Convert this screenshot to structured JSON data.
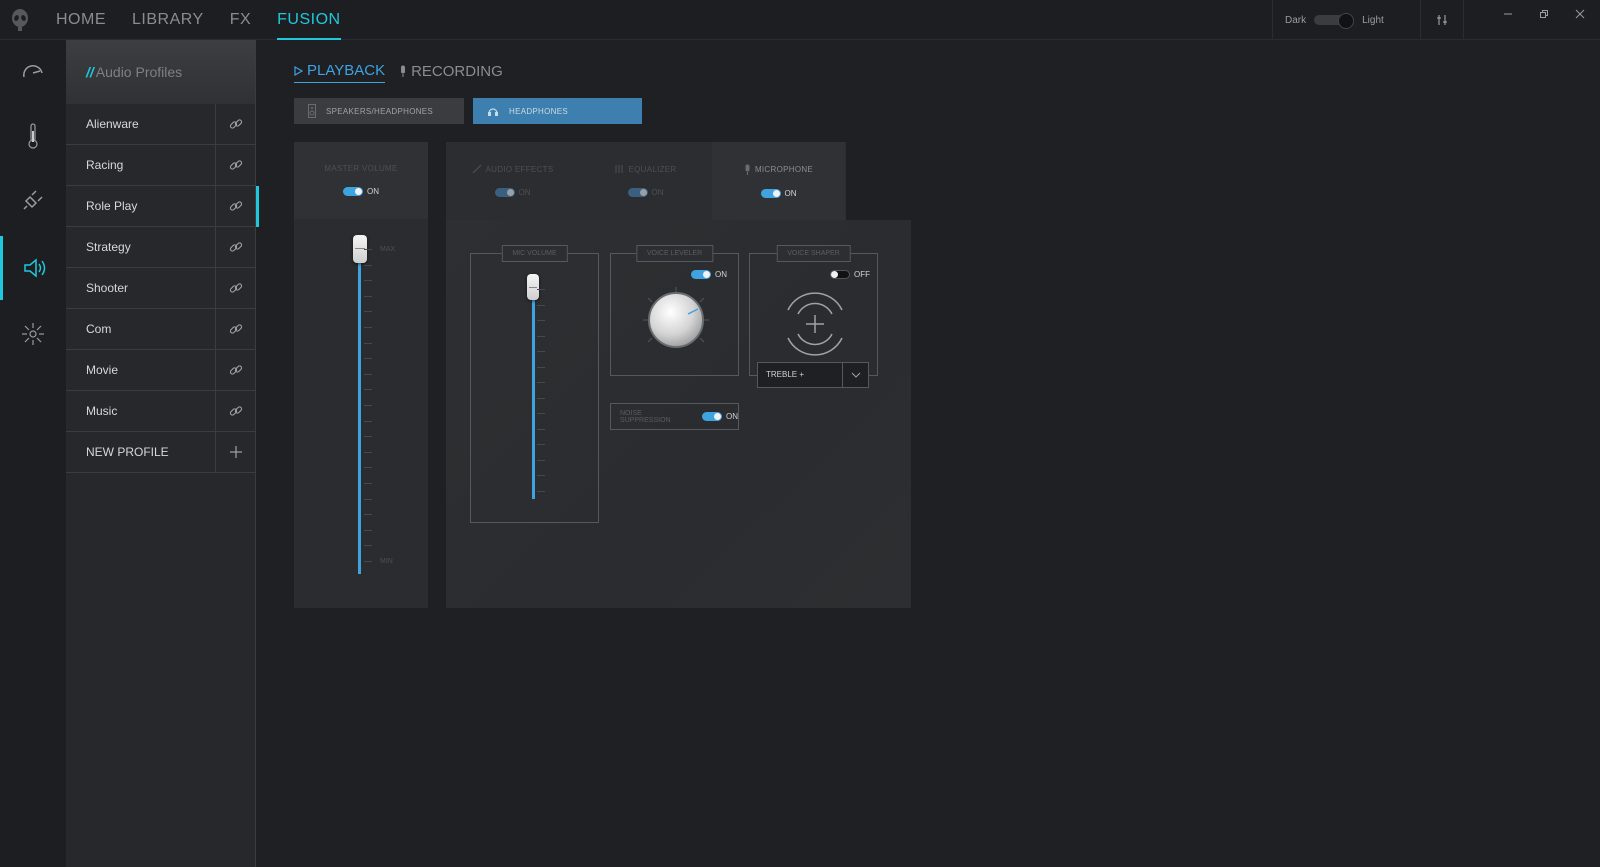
{
  "nav": {
    "items": [
      {
        "label": "HOME",
        "active": false
      },
      {
        "label": "LIBRARY",
        "active": false
      },
      {
        "label": "FX",
        "active": false
      },
      {
        "label": "FUSION",
        "active": true
      }
    ]
  },
  "theme": {
    "dark_label": "Dark",
    "light_label": "Light"
  },
  "profiles": {
    "header": "Audio Profiles",
    "header_prefix": "//",
    "items": [
      "Alienware",
      "Racing",
      "Role Play",
      "Strategy",
      "Shooter",
      "Com",
      "Movie",
      "Music"
    ],
    "active": "Role Play",
    "new_profile_label": "NEW PROFILE"
  },
  "subtabs": {
    "playback": "PLAYBACK",
    "recording": "RECORDING"
  },
  "devices": {
    "speakers": "SPEAKERS/HEADPHONES",
    "headphones": "HEADPHONES"
  },
  "master": {
    "title": "MASTER VOLUME",
    "toggle_state": "ON",
    "max_label": "MAX",
    "min_label": "MIN",
    "level": 1.0
  },
  "effects_tabs": [
    {
      "label": "AUDIO EFFECTS",
      "state": "ON"
    },
    {
      "label": "EQUALIZER",
      "state": "ON"
    },
    {
      "label": "MICROPHONE",
      "state": "ON"
    }
  ],
  "mic_volume": {
    "title": "MIC VOLUME",
    "level": 1.0
  },
  "voice_leveler": {
    "title": "VOICE LEVELER",
    "state": "ON"
  },
  "voice_shaper": {
    "title": "VOICE SHAPER",
    "state": "OFF",
    "preset": "TREBLE +"
  },
  "noise_suppression": {
    "title": "NOISE SUPPRESSION",
    "state": "ON"
  },
  "colors": {
    "accent": "#1fc8dd",
    "blue": "#3fa3e0",
    "headphones_bg": "#3d7fae"
  }
}
